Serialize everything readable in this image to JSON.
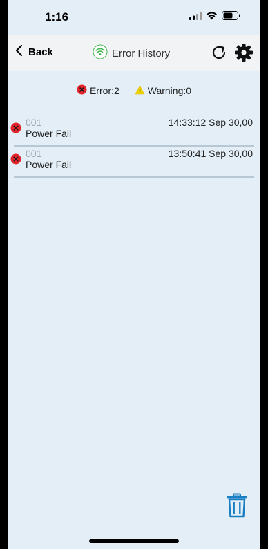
{
  "status_bar": {
    "time": "1:16",
    "icons": [
      "cellular-signal-icon",
      "wifi-icon",
      "battery-icon"
    ]
  },
  "nav": {
    "back_label": "Back",
    "title": "Error History",
    "title_icon": "wifi-connection-icon",
    "actions": [
      "refresh-icon",
      "gear-icon"
    ]
  },
  "summary": {
    "error_label": "Error:2",
    "warning_label": "Warning:0"
  },
  "errors": [
    {
      "code": "001",
      "name": "Power Fail",
      "time": "14:33:12 Sep 30,00"
    },
    {
      "code": "001",
      "name": "Power Fail",
      "time": "13:50:41 Sep 30,00"
    }
  ],
  "footer": {
    "delete_icon": "trash-icon"
  },
  "colors": {
    "background": "#e3eef7",
    "nav_background": "#f2f3f5",
    "error_red": "#e3242b",
    "warning_yellow": "#f2d400",
    "delete_blue": "#1a7fc2",
    "wifi_green": "#3cb44b"
  }
}
